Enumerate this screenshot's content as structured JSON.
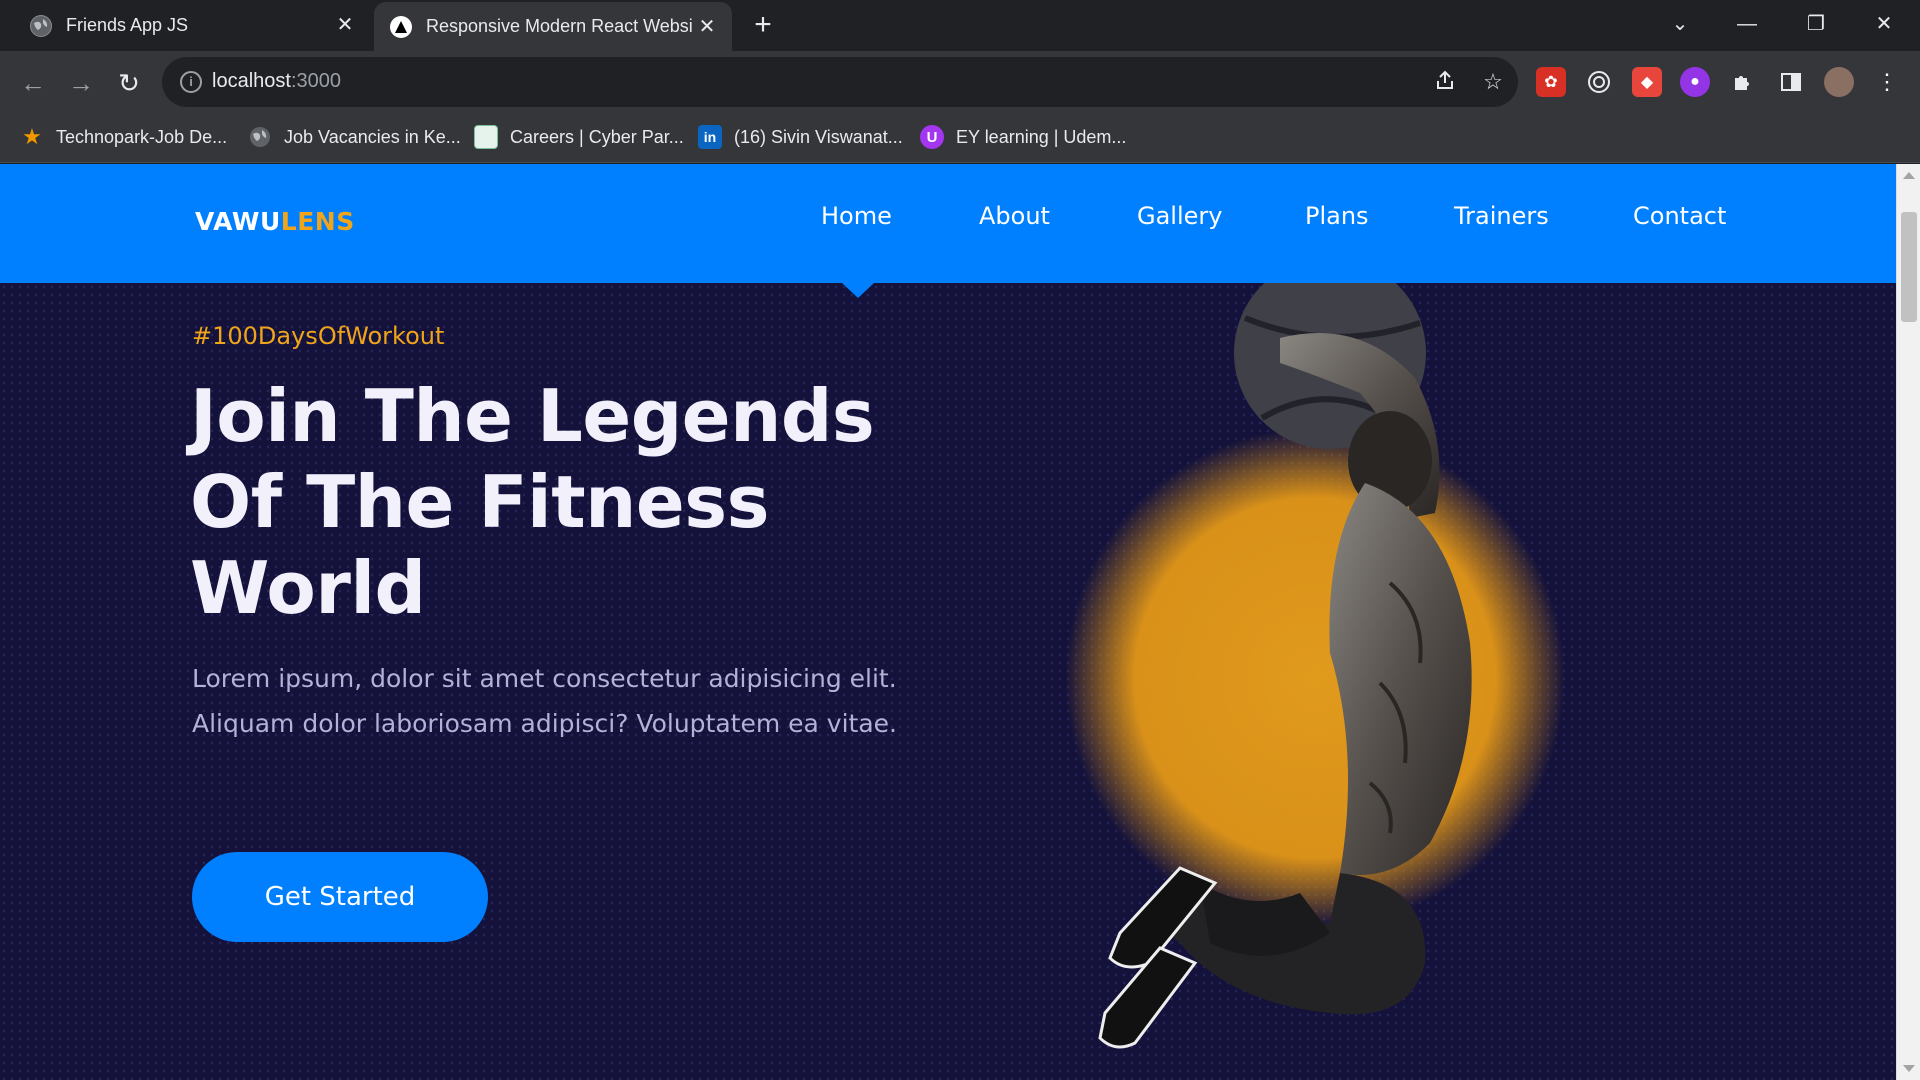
{
  "browser": {
    "tabs": [
      {
        "title": "Friends App JS",
        "active": false
      },
      {
        "title": "Responsive Modern React Websi",
        "active": true
      }
    ],
    "new_tab_symbol": "+",
    "close_symbol": "✕",
    "window_controls": {
      "tab_search": "⌄",
      "minimize": "—",
      "restore": "❐",
      "close": "✕"
    },
    "nav": {
      "back": "←",
      "forward": "→",
      "reload": "↻"
    },
    "url": {
      "host": "localhost",
      "port": ":3000"
    },
    "bookmarks": [
      {
        "label": "Technopark-Job De...",
        "icon": "star-icon"
      },
      {
        "label": "Job Vacancies in Ke...",
        "icon": "globe-icon"
      },
      {
        "label": "Careers | Cyber Par...",
        "icon": "cyberpark-icon"
      },
      {
        "label": "(16) Sivin Viswanat...",
        "icon": "linkedin-icon"
      },
      {
        "label": "EY learning | Udem...",
        "icon": "udemy-icon"
      }
    ]
  },
  "site": {
    "logo": {
      "main": "VAWU",
      "accent": "LENS"
    },
    "nav_links": [
      "Home",
      "About",
      "Gallery",
      "Plans",
      "Trainers",
      "Contact"
    ],
    "active_link": "Home",
    "colors": {
      "primary": "#0080ff",
      "accent": "#f0a41a",
      "background": "#14123a",
      "heading": "#f2f0fb",
      "body_text": "#b3b1d6"
    },
    "hero": {
      "tagline": "#100DaysOfWorkout",
      "headline": "Join The Legends Of The Fitness World",
      "description": "Lorem ipsum, dolor sit amet consectetur adipisicing elit. Aliquam dolor laboriosam adipisci? Voluptatem ea vitae.",
      "cta_label": "Get Started",
      "image": "athlete-with-medicine-ball"
    }
  }
}
